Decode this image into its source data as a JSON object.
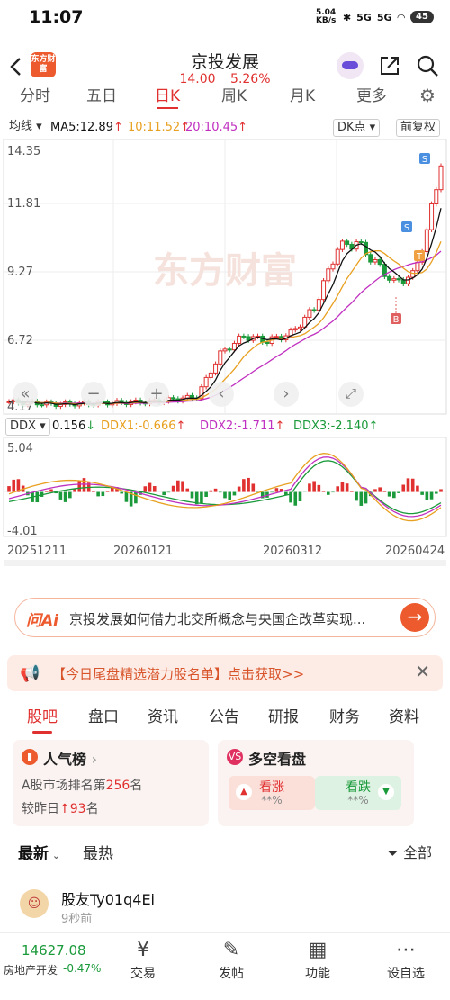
{
  "status": {
    "time": "11:07",
    "net_speed": "5.04 KB/s",
    "sig1": "5G",
    "sig2": "5G",
    "battery": "45"
  },
  "header": {
    "logo_text": "东方财富",
    "title": "京投发展",
    "price": "14.00",
    "change_pct": "5.26%"
  },
  "tabs": [
    {
      "label": "分时"
    },
    {
      "label": "五日"
    },
    {
      "label": "日K"
    },
    {
      "label": "周K"
    },
    {
      "label": "月K"
    },
    {
      "label": "更多"
    }
  ],
  "ma_row": {
    "mode": "均线",
    "ma5": "MA5:12.89",
    "ma10": "10:11.52",
    "ma20": "20:10.45",
    "dk_label": "DK点",
    "adjust_label": "前复权"
  },
  "kchart": {
    "y_labels": [
      "14.35",
      "11.81",
      "9.27",
      "6.72",
      "4.17"
    ],
    "watermark": "东方财富",
    "markers": {
      "s1": "S",
      "s2": "S",
      "b": "B",
      "t": "T"
    }
  },
  "ddx_row": {
    "name": "DDX",
    "ddx": "0.156",
    "ddx1": "DDX1:-0.666",
    "ddx2": "DDX2:-1.711",
    "ddx3": "DDX3:-2.140"
  },
  "ddxchart": {
    "y_top": "5.04",
    "y_bottom": "-4.01",
    "dates": [
      "20251211",
      "20260121",
      "20260312",
      "20260424"
    ]
  },
  "colors": {
    "up": "#e03030",
    "down": "#1a9a3a",
    "ma5": "#111111",
    "ma10": "#e8a020",
    "ma20": "#c030c0",
    "accent": "#ec5a2e"
  },
  "ask": {
    "ai_label": "问Ai",
    "question": "京投发展如何借力北交所概念与央国企改革实现..."
  },
  "promo": {
    "text": "【今日尾盘精选潜力股名单】点击获取>>"
  },
  "section_tabs": [
    {
      "label": "股吧"
    },
    {
      "label": "盘口"
    },
    {
      "label": "资讯"
    },
    {
      "label": "公告"
    },
    {
      "label": "研报"
    },
    {
      "label": "财务"
    },
    {
      "label": "资料"
    }
  ],
  "hot_card": {
    "title": "人气榜",
    "line1_prefix": "A股市场排名第",
    "rank": "256",
    "line1_suffix": "名",
    "line2_prefix": "较昨日",
    "rank_change": "93",
    "line2_suffix": "名"
  },
  "sentiment_card": {
    "title": "多空看盘",
    "bull_label": "看涨",
    "bull_value": "**%",
    "bear_label": "看跌",
    "bear_value": "**%"
  },
  "sort_row": {
    "latest": "最新",
    "hottest": "最热",
    "filter": "全部"
  },
  "post": {
    "user": "股友Ty01q4Ei",
    "time": "9秒前"
  },
  "bottom_bar": {
    "index_value": "14627.08",
    "index_name": "房地产开发",
    "index_change": "-0.47%",
    "items": [
      {
        "label": "交易"
      },
      {
        "label": "发帖"
      },
      {
        "label": "功能"
      },
      {
        "label": "设自选"
      }
    ]
  }
}
